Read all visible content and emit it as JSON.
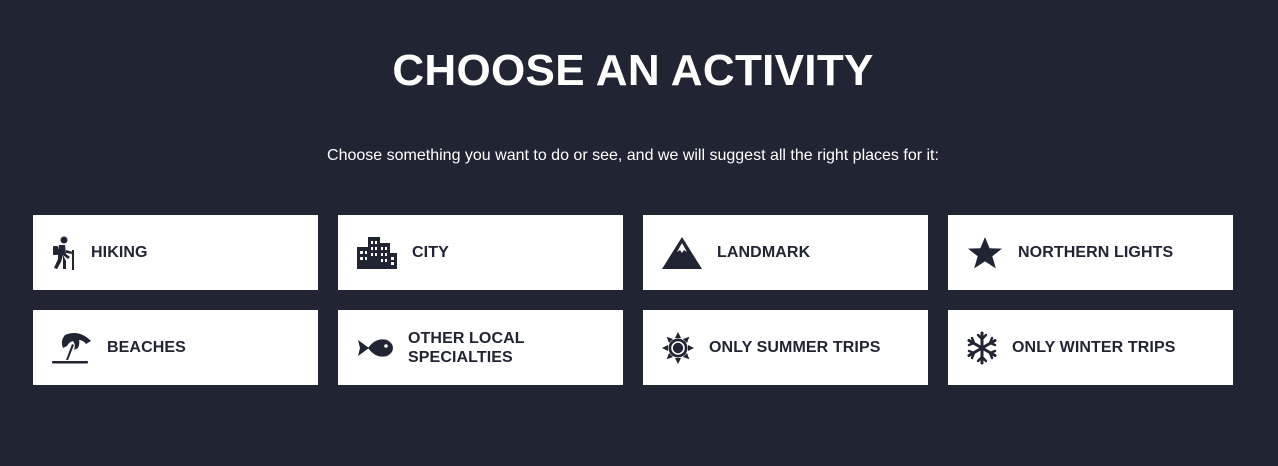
{
  "header": {
    "title": "CHOOSE AN ACTIVITY",
    "subtitle": "Choose something you want to do or see, and we will suggest all the right places for it:"
  },
  "colors": {
    "background": "#212533",
    "card": "#ffffff",
    "text_dark": "#212533"
  },
  "activities": [
    {
      "label": "HIKING",
      "icon": "hiking-icon"
    },
    {
      "label": "CITY",
      "icon": "city-icon"
    },
    {
      "label": "LANDMARK",
      "icon": "mountain-icon"
    },
    {
      "label": "NORTHERN LIGHTS",
      "icon": "star-icon"
    },
    {
      "label": "BEACHES",
      "icon": "umbrella-beach-icon"
    },
    {
      "label": "OTHER LOCAL SPECIALTIES",
      "icon": "fish-icon"
    },
    {
      "label": "ONLY SUMMER TRIPS",
      "icon": "sun-icon"
    },
    {
      "label": "ONLY WINTER TRIPS",
      "icon": "snowflake-icon"
    }
  ]
}
